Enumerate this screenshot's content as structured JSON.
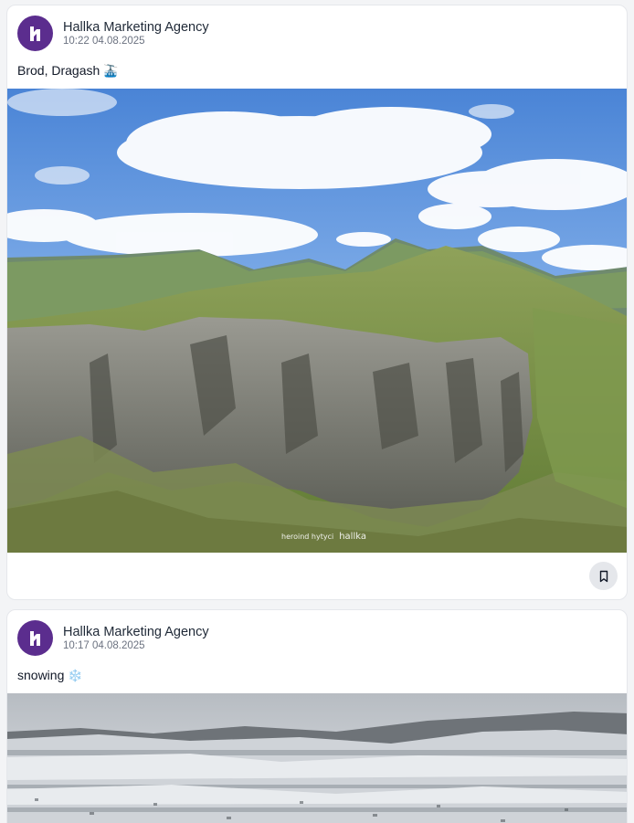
{
  "posts": [
    {
      "author": "Hallka Marketing Agency",
      "time": "10:22 04.08.2025",
      "caption": "Brod, Dragash",
      "caption_emoji": "🚠",
      "watermark_text": "heroind hytyci",
      "watermark_brand": "hallka",
      "image_subject": "mountain cliffs and green valley under blue sky"
    },
    {
      "author": "Hallka Marketing Agency",
      "time": "10:17 04.08.2025",
      "caption": "snowing",
      "caption_emoji": "❄️",
      "image_subject": "snow-covered valley and village"
    }
  ],
  "colors": {
    "avatar_bg": "#5b2d8e",
    "page_bg": "#f3f4f6",
    "card_bg": "#ffffff"
  },
  "icons": {
    "avatar_logo": "hallka-logo",
    "bookmark": "bookmark-icon"
  }
}
